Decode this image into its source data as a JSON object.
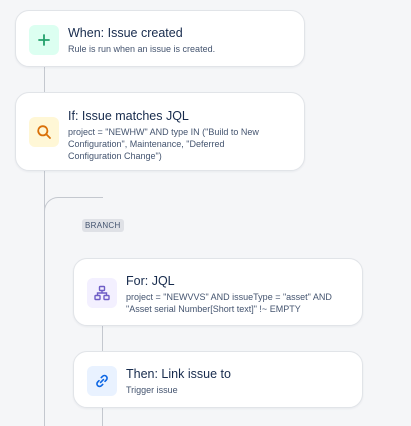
{
  "flow": {
    "trigger": {
      "title": "When: Issue created",
      "description": "Rule is run when an issue is created.",
      "icon": "plus-icon",
      "icon_bg": "#dcfff1",
      "icon_color": "#22a06b"
    },
    "condition": {
      "title": "If: Issue matches JQL",
      "description": "project = \"NEWHW\" AND type IN (\"Build to New Configuration\", Maintenance, \"Deferred Configuration Change\")",
      "icon": "search-icon",
      "icon_bg": "#fff7d6",
      "icon_color": "#d97008"
    },
    "branch_label": "BRANCH",
    "branch": {
      "title": "For: JQL",
      "description": "project = \"NEWVVS\" AND issueType = \"asset\" AND \"Asset serial Number[Short text]\" !~ EMPTY",
      "icon": "hierarchy-icon",
      "icon_bg": "#f3f0ff",
      "icon_color": "#6e5dc6"
    },
    "action": {
      "title": "Then: Link issue to",
      "description": "Trigger issue",
      "icon": "link-icon",
      "icon_bg": "#e9f2ff",
      "icon_color": "#0c66e4"
    }
  }
}
